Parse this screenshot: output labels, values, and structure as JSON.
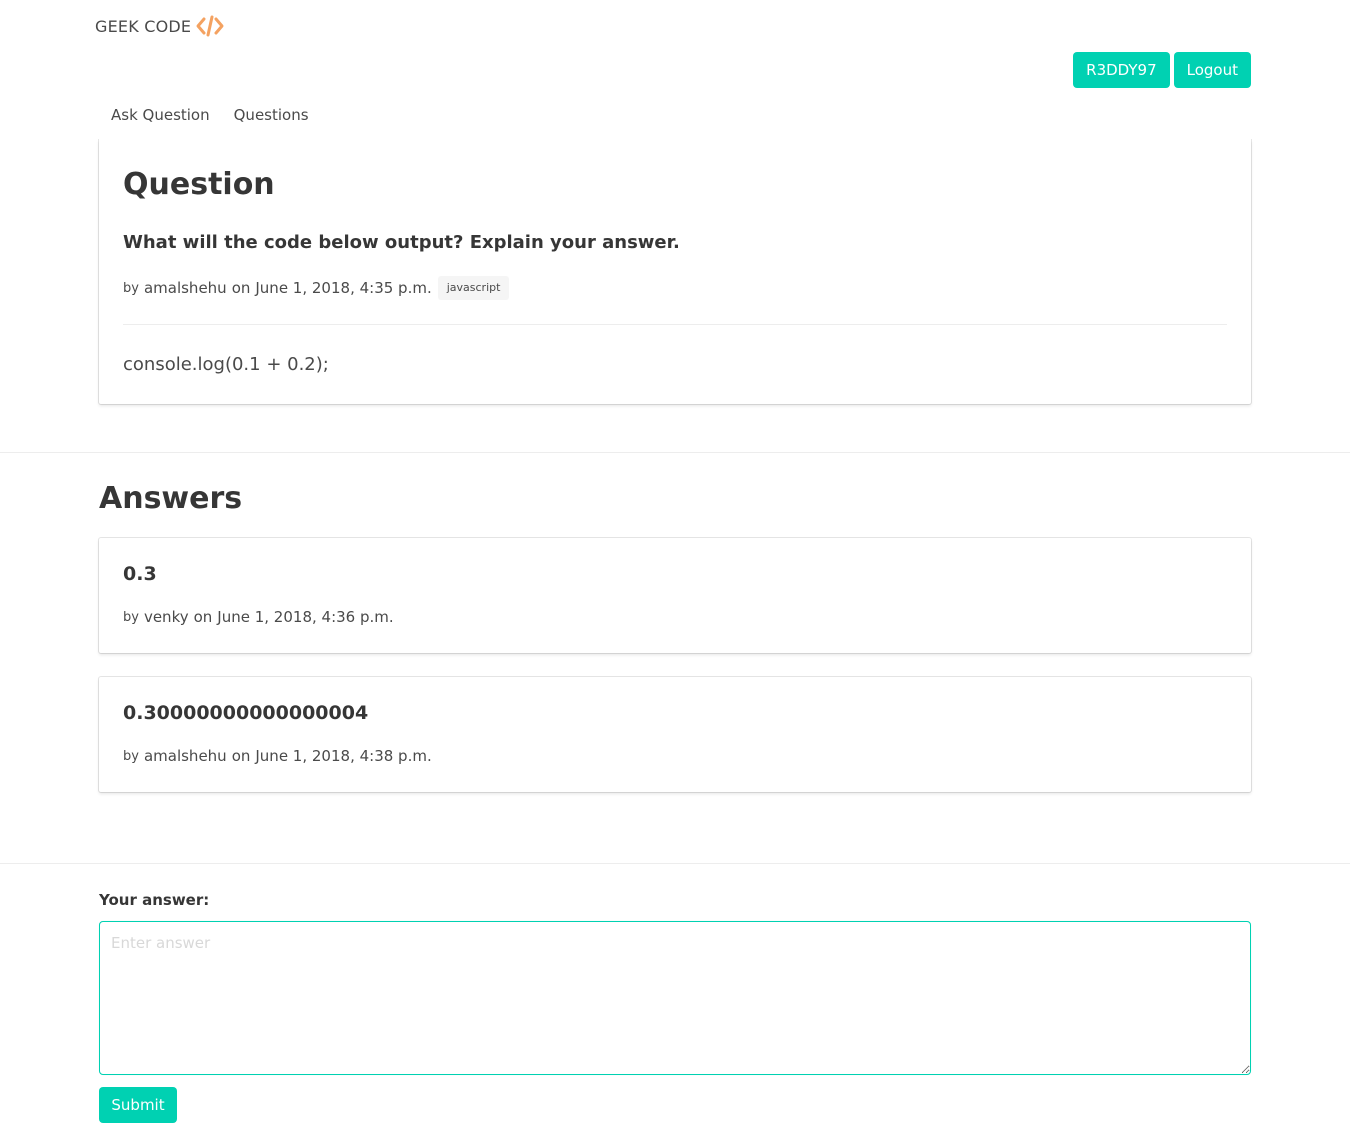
{
  "header": {
    "brand_name": "GEEK CODE",
    "brand_icon": "code-icon",
    "accent_color": "#00d1b2",
    "brand_icon_color": "#f4a261",
    "username_button": "R3DDY97",
    "logout_button": "Logout"
  },
  "nav": {
    "items": [
      {
        "label": "Ask Question"
      },
      {
        "label": "Questions"
      }
    ]
  },
  "question": {
    "heading": "Question",
    "title": "What will the code below output? Explain your answer.",
    "by_label": "by",
    "author": "amalshehu",
    "on_label": "on",
    "date": "June 1, 2018, 4:35 p.m.",
    "tag": "javascript",
    "body": "console.log(0.1 + 0.2);"
  },
  "answers": {
    "heading": "Answers",
    "items": [
      {
        "text": "0.3",
        "by_label": "by",
        "author": "venky",
        "on_label": "on",
        "date": "June 1, 2018, 4:36 p.m."
      },
      {
        "text": "0.30000000000000004",
        "by_label": "by",
        "author": "amalshehu",
        "on_label": "on",
        "date": "June 1, 2018, 4:38 p.m."
      }
    ]
  },
  "form": {
    "label": "Your answer:",
    "placeholder": "Enter answer",
    "submit": "Submit"
  }
}
